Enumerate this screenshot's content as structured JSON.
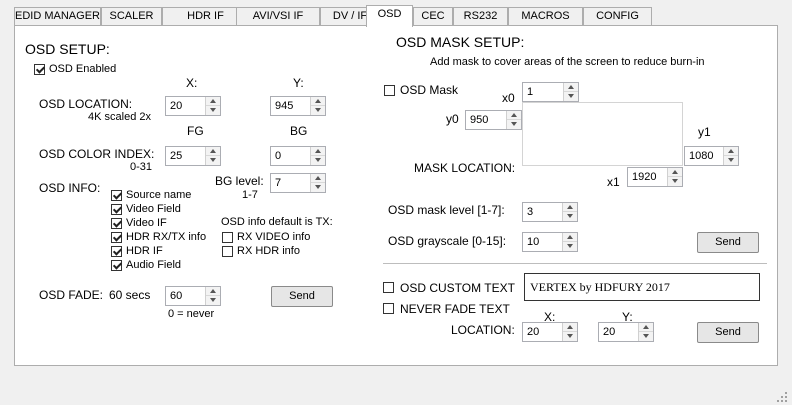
{
  "tabs": [
    {
      "label": "EDID MANAGER"
    },
    {
      "label": "SCALER"
    },
    {
      "label": "HDR IF"
    },
    {
      "label": "AVI/VSI IF"
    },
    {
      "label": "DV / IF"
    },
    {
      "label": "OSD"
    },
    {
      "label": "CEC"
    },
    {
      "label": "RS232"
    },
    {
      "label": "MACROS"
    },
    {
      "label": "CONFIG"
    }
  ],
  "active_tab": "OSD",
  "osd_setup": {
    "title": "OSD SETUP:",
    "enabled_label": "OSD Enabled",
    "enabled": true,
    "x_header": "X:",
    "y_header": "Y:",
    "location_label": "OSD LOCATION:",
    "location_sub": "4K scaled 2x",
    "location_x": "20",
    "location_y": "945",
    "fg_header": "FG",
    "bg_header": "BG",
    "color_label": "OSD COLOR INDEX:",
    "color_sub": "0-31",
    "color_fg": "25",
    "color_bg": "0",
    "info_label": "OSD INFO:",
    "bg_level_label": "BG level:",
    "bg_level_range": "1-7",
    "bg_level": "7",
    "info_items": [
      {
        "label": "Source name",
        "checked": true
      },
      {
        "label": "Video Field",
        "checked": true
      },
      {
        "label": "Video IF",
        "checked": true
      },
      {
        "label": "HDR RX/TX info",
        "checked": true
      },
      {
        "label": "HDR IF",
        "checked": true
      },
      {
        "label": "Audio Field",
        "checked": true
      }
    ],
    "default_note": "OSD info default is TX:",
    "rx_items": [
      {
        "label": "RX VIDEO info",
        "checked": false
      },
      {
        "label": "RX HDR info",
        "checked": false
      }
    ],
    "fade_label": "OSD FADE:",
    "fade_secs": "60 secs",
    "fade_value": "60",
    "fade_note": "0 = never",
    "send_label": "Send"
  },
  "mask_setup": {
    "title": "OSD MASK SETUP:",
    "subtitle": "Add mask to cover areas of the screen to reduce burn-in",
    "mask_label": "OSD Mask",
    "mask_checked": false,
    "x0_label": "x0",
    "x0": "1",
    "y0_label": "y0",
    "y0": "950",
    "y1_label": "y1",
    "y1": "1080",
    "x1_label": "x1",
    "x1": "1920",
    "location_label": "MASK LOCATION:",
    "level_label": "OSD mask level [1-7]:",
    "level": "3",
    "gray_label": "OSD grayscale [0-15]:",
    "gray": "10",
    "send_label": "Send"
  },
  "custom_text": {
    "custom_label": "OSD CUSTOM TEXT",
    "custom_checked": false,
    "text": "VERTEX by HDFURY 2017",
    "never_fade_label": "NEVER FADE TEXT",
    "never_fade_checked": false,
    "location_label": "LOCATION:",
    "x_header": "X:",
    "y_header": "Y:",
    "x": "20",
    "y": "20",
    "send_label": "Send"
  }
}
